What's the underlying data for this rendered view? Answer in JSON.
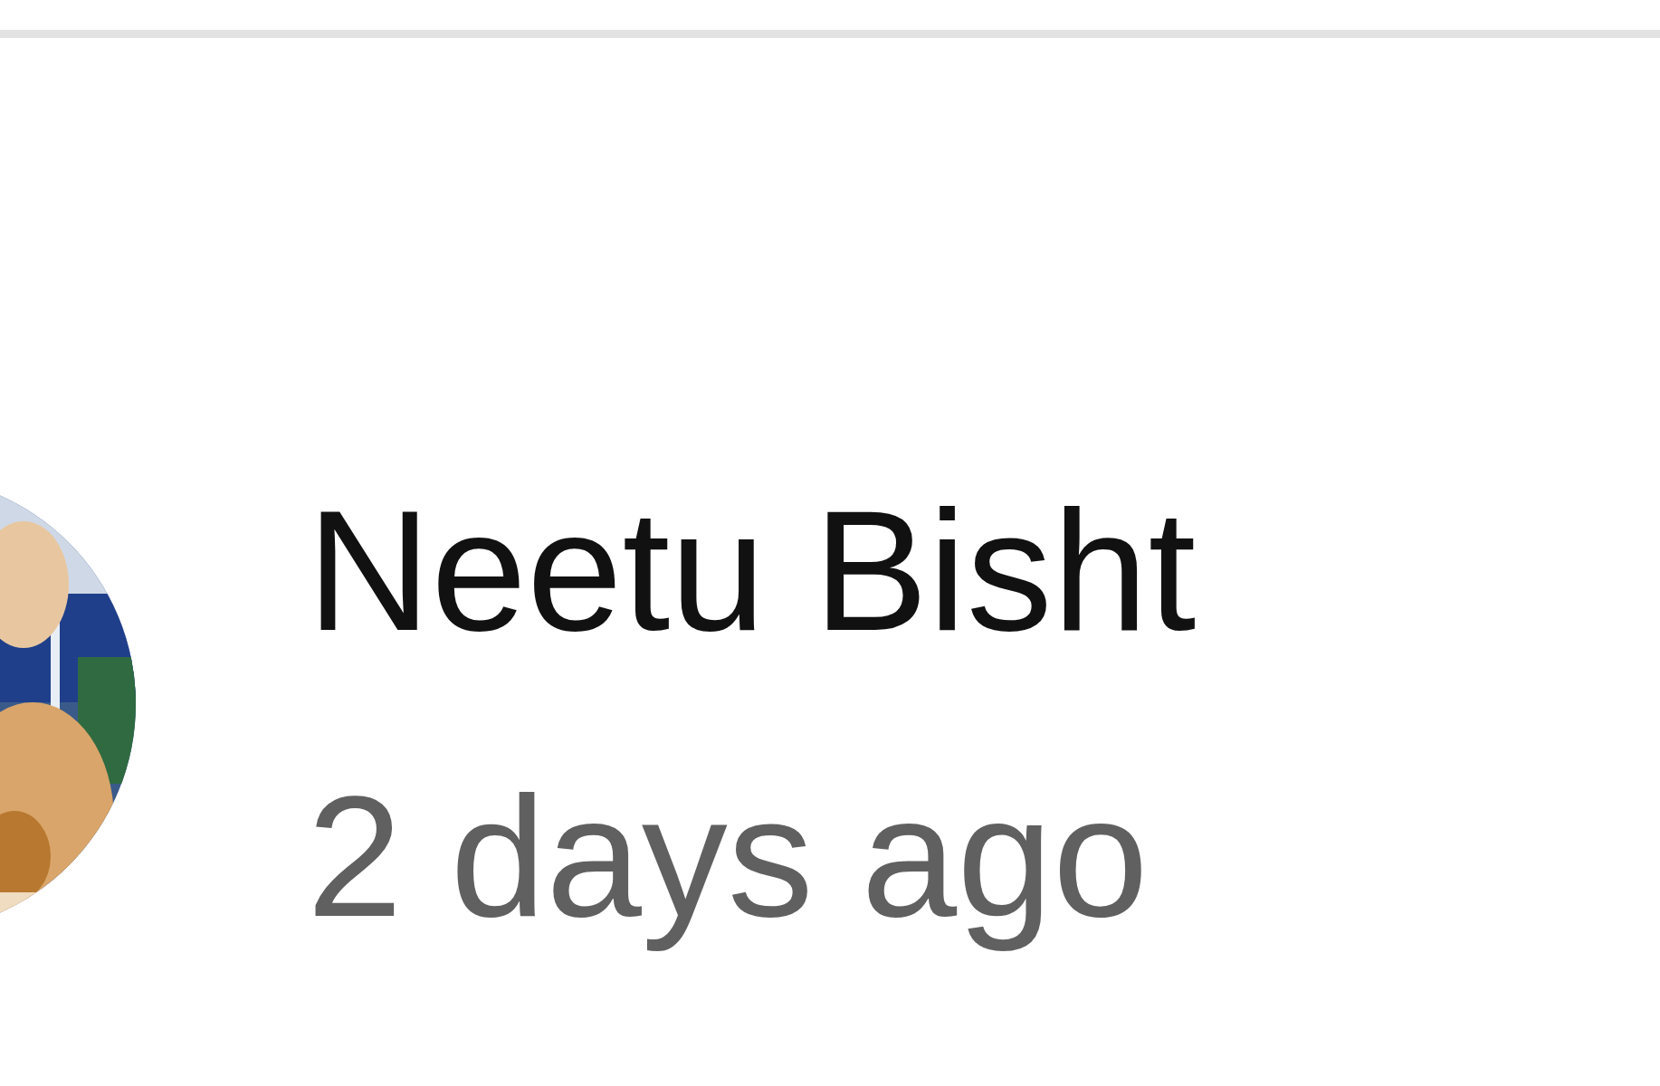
{
  "comment": {
    "author": "Neetu Bisht",
    "time": "2 days ago"
  }
}
